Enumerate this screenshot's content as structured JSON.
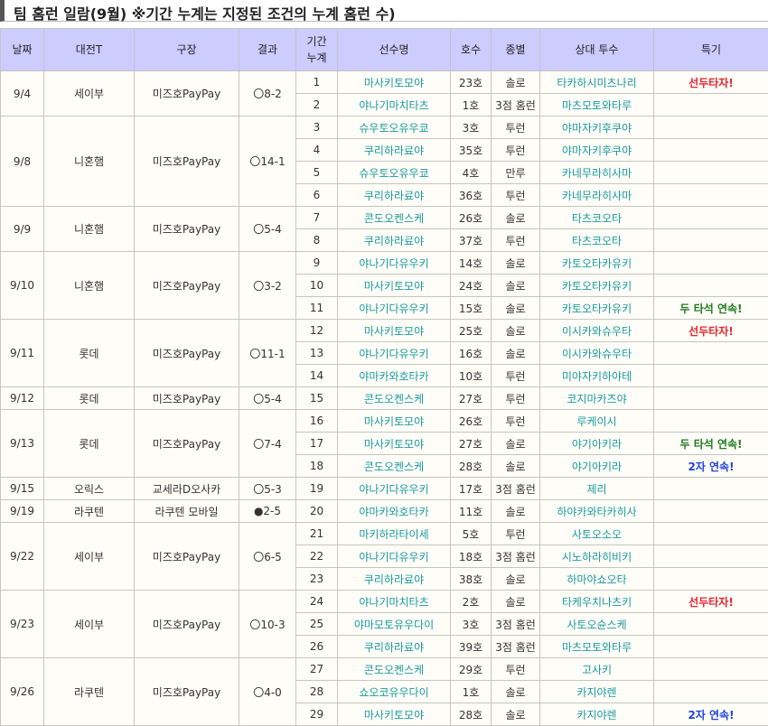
{
  "title": "팀 홈런 일람(9월) ※기간 누계는 지정된 조건의 누계 홈런 수)",
  "headers": {
    "date": "날짜",
    "opponent": "대전T",
    "stadium": "구장",
    "result": "결과",
    "cumulative_line1": "기간",
    "cumulative_line2": "누계",
    "player": "선수명",
    "hr_no": "호수",
    "type": "종별",
    "pitcher": "상대 투수",
    "note": "특기"
  },
  "colors": {
    "header_bg": "#ccccff",
    "player_text": "#1a9aa0",
    "note_red": "#e8232e",
    "note_green": "#1f7a1f",
    "note_blue": "#2244dd"
  },
  "games": [
    {
      "date": "9/4",
      "opponent": "세이부",
      "stadium": "미즈호PayPay",
      "result": "〇8-2",
      "rows": [
        {
          "n": "1",
          "player": "마사키토모야",
          "hr": "23호",
          "type": "솔로",
          "pitcher": "타카하시미츠나리",
          "note": "선두타자!",
          "note_color": "red"
        },
        {
          "n": "2",
          "player": "야나기마치타츠",
          "hr": "1호",
          "type": "3점 홈런",
          "pitcher": "마츠모토와타루",
          "note": "",
          "note_color": ""
        }
      ]
    },
    {
      "date": "9/8",
      "opponent": "니혼햄",
      "stadium": "미즈호PayPay",
      "result": "〇14-1",
      "rows": [
        {
          "n": "3",
          "player": "슈우토오유우쿄",
          "hr": "3호",
          "type": "투런",
          "pitcher": "야마자키후쿠야",
          "note": "",
          "note_color": ""
        },
        {
          "n": "4",
          "player": "쿠리하라료야",
          "hr": "35호",
          "type": "투런",
          "pitcher": "야마자키후쿠야",
          "note": "",
          "note_color": ""
        },
        {
          "n": "5",
          "player": "슈우토오유우쿄",
          "hr": "4호",
          "type": "만루",
          "pitcher": "카네무라히사마",
          "note": "",
          "note_color": ""
        },
        {
          "n": "6",
          "player": "쿠리하라료야",
          "hr": "36호",
          "type": "투런",
          "pitcher": "카네무라히사마",
          "note": "",
          "note_color": ""
        }
      ]
    },
    {
      "date": "9/9",
      "opponent": "니혼햄",
      "stadium": "미즈호PayPay",
      "result": "〇5-4",
      "rows": [
        {
          "n": "7",
          "player": "콘도오켄스케",
          "hr": "26호",
          "type": "솔로",
          "pitcher": "타츠코오타",
          "note": "",
          "note_color": ""
        },
        {
          "n": "8",
          "player": "쿠리하라료야",
          "hr": "37호",
          "type": "투런",
          "pitcher": "타츠코오타",
          "note": "",
          "note_color": ""
        }
      ]
    },
    {
      "date": "9/10",
      "opponent": "니혼햄",
      "stadium": "미즈호PayPay",
      "result": "〇3-2",
      "rows": [
        {
          "n": "9",
          "player": "야나기다유우키",
          "hr": "14호",
          "type": "솔로",
          "pitcher": "카토오타카유키",
          "note": "",
          "note_color": ""
        },
        {
          "n": "10",
          "player": "마사키토모야",
          "hr": "24호",
          "type": "솔로",
          "pitcher": "카토오타카유키",
          "note": "",
          "note_color": ""
        },
        {
          "n": "11",
          "player": "야나기다유우키",
          "hr": "15호",
          "type": "솔로",
          "pitcher": "카토오타카유키",
          "note": "두 타석 연속!",
          "note_color": "green"
        }
      ]
    },
    {
      "date": "9/11",
      "opponent": "롯데",
      "stadium": "미즈호PayPay",
      "result": "〇11-1",
      "rows": [
        {
          "n": "12",
          "player": "마사키토모야",
          "hr": "25호",
          "type": "솔로",
          "pitcher": "이시카와슈우타",
          "note": "선두타자!",
          "note_color": "red"
        },
        {
          "n": "13",
          "player": "야나기다유우키",
          "hr": "16호",
          "type": "솔로",
          "pitcher": "이시카와슈우타",
          "note": "",
          "note_color": ""
        },
        {
          "n": "14",
          "player": "야마카와호타카",
          "hr": "10호",
          "type": "투런",
          "pitcher": "미야자키하야테",
          "note": "",
          "note_color": ""
        }
      ]
    },
    {
      "date": "9/12",
      "opponent": "롯데",
      "stadium": "미즈호PayPay",
      "result": "〇5-4",
      "rows": [
        {
          "n": "15",
          "player": "콘도오켄스케",
          "hr": "27호",
          "type": "투런",
          "pitcher": "코지마카즈야",
          "note": "",
          "note_color": ""
        }
      ]
    },
    {
      "date": "9/13",
      "opponent": "롯데",
      "stadium": "미즈호PayPay",
      "result": "〇7-4",
      "rows": [
        {
          "n": "16",
          "player": "마사키토모야",
          "hr": "26호",
          "type": "투런",
          "pitcher": "루케이시",
          "note": "",
          "note_color": ""
        },
        {
          "n": "17",
          "player": "마사키토모야",
          "hr": "27호",
          "type": "솔로",
          "pitcher": "야기아키라",
          "note": "두 타석 연속!",
          "note_color": "green"
        },
        {
          "n": "18",
          "player": "콘도오켄스케",
          "hr": "28호",
          "type": "솔로",
          "pitcher": "야기아키라",
          "note": "2자 연속!",
          "note_color": "blue"
        }
      ]
    },
    {
      "date": "9/15",
      "opponent": "오릭스",
      "stadium": "교세라D오사카",
      "result": "〇5-3",
      "rows": [
        {
          "n": "19",
          "player": "야나기다유우키",
          "hr": "17호",
          "type": "3점 홈런",
          "pitcher": "제리",
          "note": "",
          "note_color": ""
        }
      ]
    },
    {
      "date": "9/19",
      "opponent": "라쿠텐",
      "stadium": "라쿠텐 모바일",
      "result": "●2-5",
      "rows": [
        {
          "n": "20",
          "player": "야마카와호타카",
          "hr": "11호",
          "type": "솔로",
          "pitcher": "하야카와타카히사",
          "note": "",
          "note_color": ""
        }
      ]
    },
    {
      "date": "9/22",
      "opponent": "세이부",
      "stadium": "미즈호PayPay",
      "result": "〇6-5",
      "rows": [
        {
          "n": "21",
          "player": "마키하라타이세",
          "hr": "5호",
          "type": "투런",
          "pitcher": "사토오소오",
          "note": "",
          "note_color": ""
        },
        {
          "n": "22",
          "player": "야나기다유우키",
          "hr": "18호",
          "type": "3점 홈런",
          "pitcher": "시노하라히비키",
          "note": "",
          "note_color": ""
        },
        {
          "n": "23",
          "player": "쿠리하라료야",
          "hr": "38호",
          "type": "솔로",
          "pitcher": "하마야쇼오타",
          "note": "",
          "note_color": ""
        }
      ]
    },
    {
      "date": "9/23",
      "opponent": "세이부",
      "stadium": "미즈호PayPay",
      "result": "〇10-3",
      "rows": [
        {
          "n": "24",
          "player": "야나기마치타츠",
          "hr": "2호",
          "type": "솔로",
          "pitcher": "타케우치나츠키",
          "note": "선두타자!",
          "note_color": "red"
        },
        {
          "n": "25",
          "player": "야마모토유우다이",
          "hr": "3호",
          "type": "3점 홈런",
          "pitcher": "사토오슌스케",
          "note": "",
          "note_color": ""
        },
        {
          "n": "26",
          "player": "쿠리하라료야",
          "hr": "39호",
          "type": "3점 홈런",
          "pitcher": "마츠모토와타루",
          "note": "",
          "note_color": ""
        }
      ]
    },
    {
      "date": "9/26",
      "opponent": "라쿠텐",
      "stadium": "미즈호PayPay",
      "result": "〇4-0",
      "rows": [
        {
          "n": "27",
          "player": "콘도오켄스케",
          "hr": "29호",
          "type": "투런",
          "pitcher": "고사키",
          "note": "",
          "note_color": ""
        },
        {
          "n": "28",
          "player": "쇼오코유우다이",
          "hr": "1호",
          "type": "솔로",
          "pitcher": "카지야렌",
          "note": "",
          "note_color": ""
        },
        {
          "n": "29",
          "player": "마사키토모야",
          "hr": "28호",
          "type": "솔로",
          "pitcher": "카지야렌",
          "note": "2자 연속!",
          "note_color": "blue"
        }
      ]
    }
  ]
}
